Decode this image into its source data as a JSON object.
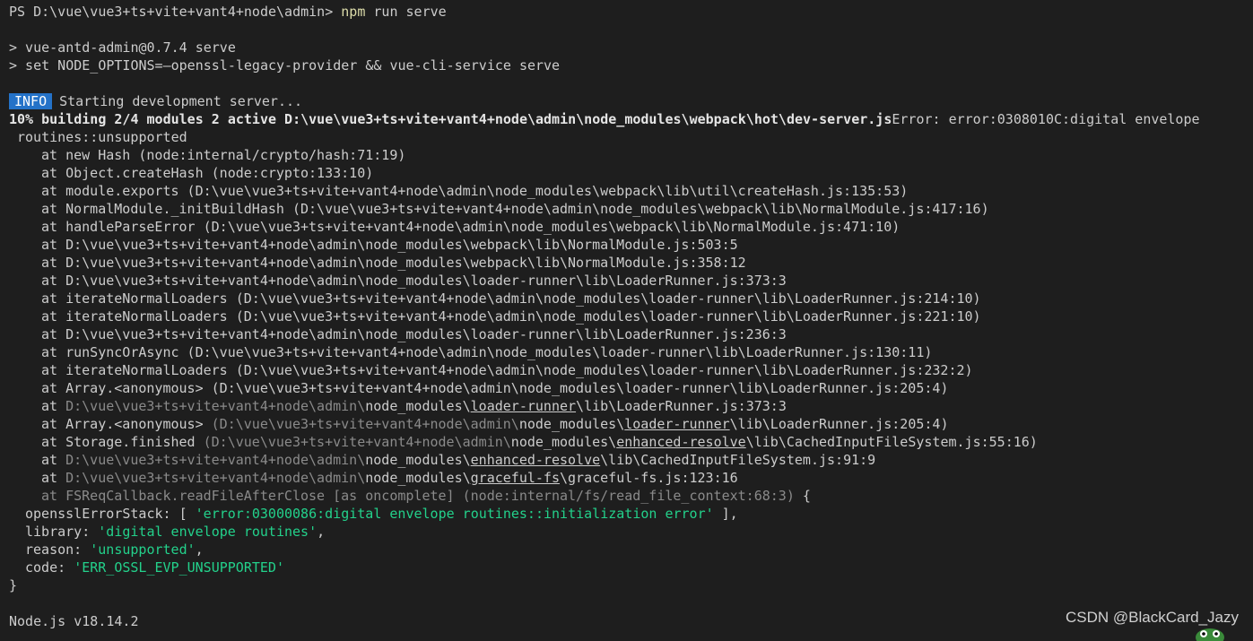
{
  "prompt": {
    "path": "PS D:\\vue\\vue3+ts+vite+vant4+node\\admin> ",
    "cmd_npm": "npm",
    "cmd_rest": " run serve"
  },
  "npm_lines": [
    "> vue-antd-admin@0.7.4 serve",
    "> set NODE_OPTIONS=—openssl-legacy-provider && vue-cli-service serve"
  ],
  "info": {
    "badge": "INFO",
    "text": "Starting development server..."
  },
  "building": {
    "bold": "10% building 2/4 modules 2 active D:\\vue\\vue3+ts+vite+vant4+node\\admin\\node_modules\\webpack\\hot\\dev-server.js",
    "rest": "Error: error:0308010C:digital envelope"
  },
  "routines": "routines::unsupported",
  "stack": [
    "at new Hash (node:internal/crypto/hash:71:19)",
    "at Object.createHash (node:crypto:133:10)",
    "at module.exports (D:\\vue\\vue3+ts+vite+vant4+node\\admin\\node_modules\\webpack\\lib\\util\\createHash.js:135:53)",
    "at NormalModule._initBuildHash (D:\\vue\\vue3+ts+vite+vant4+node\\admin\\node_modules\\webpack\\lib\\NormalModule.js:417:16)",
    "at handleParseError (D:\\vue\\vue3+ts+vite+vant4+node\\admin\\node_modules\\webpack\\lib\\NormalModule.js:471:10)",
    "at D:\\vue\\vue3+ts+vite+vant4+node\\admin\\node_modules\\webpack\\lib\\NormalModule.js:503:5",
    "at D:\\vue\\vue3+ts+vite+vant4+node\\admin\\node_modules\\webpack\\lib\\NormalModule.js:358:12",
    "at D:\\vue\\vue3+ts+vite+vant4+node\\admin\\node_modules\\loader-runner\\lib\\LoaderRunner.js:373:3",
    "at iterateNormalLoaders (D:\\vue\\vue3+ts+vite+vant4+node\\admin\\node_modules\\loader-runner\\lib\\LoaderRunner.js:214:10)",
    "at iterateNormalLoaders (D:\\vue\\vue3+ts+vite+vant4+node\\admin\\node_modules\\loader-runner\\lib\\LoaderRunner.js:221:10)",
    "at D:\\vue\\vue3+ts+vite+vant4+node\\admin\\node_modules\\loader-runner\\lib\\LoaderRunner.js:236:3",
    "at runSyncOrAsync (D:\\vue\\vue3+ts+vite+vant4+node\\admin\\node_modules\\loader-runner\\lib\\LoaderRunner.js:130:11)",
    "at iterateNormalLoaders (D:\\vue\\vue3+ts+vite+vant4+node\\admin\\node_modules\\loader-runner\\lib\\LoaderRunner.js:232:2)",
    "at Array.<anonymous> (D:\\vue\\vue3+ts+vite+vant4+node\\admin\\node_modules\\loader-runner\\lib\\LoaderRunner.js:205:4)"
  ],
  "stack_dim": {
    "l1": {
      "at": "at ",
      "dim": "D:\\vue\\vue3+ts+vite+vant4+node\\admin\\",
      "a": "node_modules\\",
      "u": "loader-runner",
      "b": "\\lib\\LoaderRunner.js:373:3"
    },
    "l2": {
      "pre": "at Array.<anonymous> ",
      "dim": "(D:\\vue\\vue3+ts+vite+vant4+node\\admin\\",
      "a": "node_modules\\",
      "u": "loader-runner",
      "b": "\\lib\\LoaderRunner.js:205:4)"
    },
    "l3": {
      "pre": "at Storage.finished ",
      "dim": "(D:\\vue\\vue3+ts+vite+vant4+node\\admin\\",
      "a": "node_modules\\",
      "u": "enhanced-resolve",
      "b": "\\lib\\CachedInputFileSystem.js:55:16)"
    },
    "l4": {
      "at": "at ",
      "dim": "D:\\vue\\vue3+ts+vite+vant4+node\\admin\\",
      "a": "node_modules\\",
      "u": "enhanced-resolve",
      "b": "\\lib\\CachedInputFileSystem.js:91:9"
    },
    "l5": {
      "at": "at ",
      "dim": "D:\\vue\\vue3+ts+vite+vant4+node\\admin\\",
      "a": "node_modules\\",
      "u": "graceful-fs",
      "b": "\\graceful-fs.js:123:16"
    },
    "l6": {
      "dim": "at FSReqCallback.readFileAfterClose [as oncomplete] (node:internal/fs/read_file_context:68:3)",
      "b": " {"
    }
  },
  "error_obj": {
    "stack_key": "opensslErrorStack: [ ",
    "stack_val": "'error:03000086:digital envelope routines::initialization error'",
    "stack_end": " ],",
    "library_key": "library: ",
    "library_val": "'digital envelope routines'",
    "library_end": ",",
    "reason_key": "reason: ",
    "reason_val": "'unsupported'",
    "reason_end": ",",
    "code_key": "code: ",
    "code_val": "'ERR_OSSL_EVP_UNSUPPORTED'",
    "close": "}"
  },
  "node_version": "Node.js v18.14.2",
  "watermark": "CSDN @BlackCard_Jazy",
  "colors": {
    "background": "#1e1e1e",
    "foreground": "#cccccc",
    "command": "#dcdcaa",
    "string": "#23d18b",
    "badge": "#2472c8",
    "dim": "#8a8a8a"
  }
}
